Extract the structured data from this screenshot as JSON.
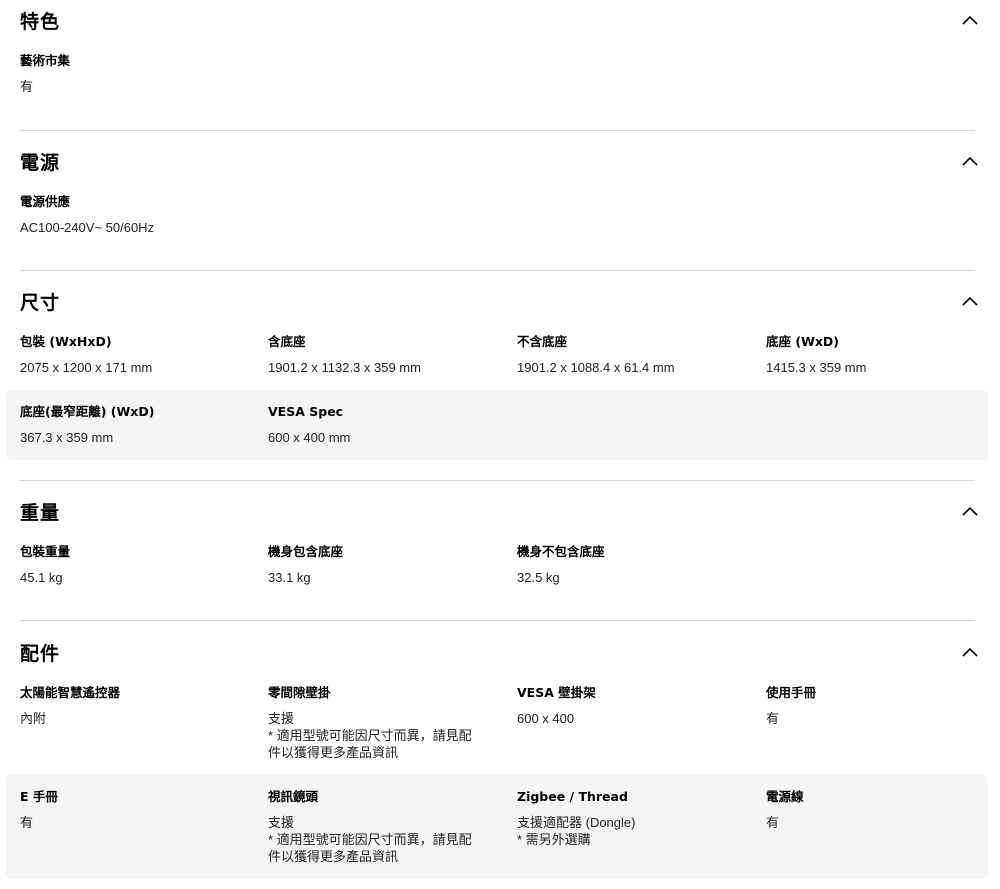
{
  "features": {
    "title": "特色",
    "items": [
      {
        "label": "藝術市集",
        "value": "有"
      }
    ]
  },
  "power": {
    "title": "電源",
    "items": [
      {
        "label": "電源供應",
        "value": "AC100-240V~ 50/60Hz"
      }
    ]
  },
  "dimensions": {
    "title": "尺寸",
    "items": [
      {
        "label": "包裝 (WxHxD)",
        "value": "2075 x 1200 x 171 mm"
      },
      {
        "label": "含底座",
        "value": "1901.2 x 1132.3 x 359 mm"
      },
      {
        "label": "不含底座",
        "value": "1901.2 x 1088.4 x 61.4 mm"
      },
      {
        "label": "底座 (WxD)",
        "value": "1415.3 x 359 mm"
      },
      {
        "label": "底座(最窄距離) (WxD)",
        "value": "367.3 x 359 mm"
      },
      {
        "label": "VESA Spec",
        "value": "600 x 400 mm"
      }
    ]
  },
  "weight": {
    "title": "重量",
    "items": [
      {
        "label": "包裝重量",
        "value": "45.1 kg"
      },
      {
        "label": "機身包含底座",
        "value": "33.1 kg"
      },
      {
        "label": "機身不包含底座",
        "value": "32.5 kg"
      }
    ]
  },
  "accessories": {
    "title": "配件",
    "items": [
      {
        "label": "太陽能智慧遙控器",
        "value": "內附"
      },
      {
        "label": "零間隙壁掛",
        "value": "支援\n* 適用型號可能因尺寸而異，請見配\n件以獲得更多產品資訊"
      },
      {
        "label": "VESA 壁掛架",
        "value": "600 x 400"
      },
      {
        "label": "使用手冊",
        "value": "有"
      },
      {
        "label": "E 手冊",
        "value": "有"
      },
      {
        "label": "視訊鏡頭",
        "value": "支援\n* 適用型號可能因尺寸而異，請見配\n件以獲得更多產品資訊"
      },
      {
        "label": "Zigbee / Thread",
        "value": "支援適配器 (Dongle)\n* 需另外選購"
      },
      {
        "label": "電源線",
        "value": "有"
      }
    ]
  }
}
